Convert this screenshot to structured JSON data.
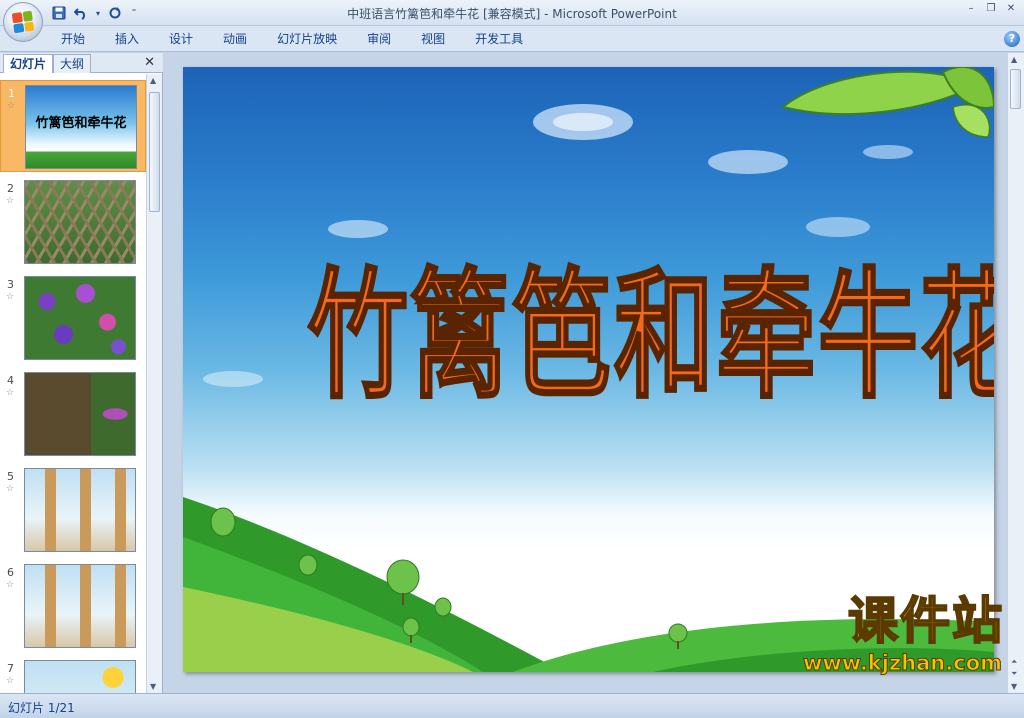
{
  "window": {
    "title": "中班语言竹篱笆和牵牛花 [兼容模式] - Microsoft PowerPoint"
  },
  "qat": {
    "save_icon": "save-icon",
    "undo_icon": "undo-icon",
    "redo_icon": "redo-icon",
    "customize_icon": "customize-qat-icon"
  },
  "ribbon": {
    "tabs": [
      "开始",
      "插入",
      "设计",
      "动画",
      "幻灯片放映",
      "审阅",
      "视图",
      "开发工具"
    ]
  },
  "pane": {
    "tab_slides": "幻灯片",
    "tab_outline": "大纲",
    "close_label": "✕"
  },
  "thumbnails": [
    {
      "number": "1",
      "caption": "竹篱笆和牵牛花"
    },
    {
      "number": "2"
    },
    {
      "number": "3"
    },
    {
      "number": "4"
    },
    {
      "number": "5"
    },
    {
      "number": "6"
    },
    {
      "number": "7"
    }
  ],
  "slide": {
    "title": "竹篱笆和牵牛花"
  },
  "watermark": {
    "name": "课件站",
    "url": "www.kjzhan.com"
  },
  "status": {
    "slide_info": "幻灯片 1/21"
  },
  "colors": {
    "accent": "#15428b",
    "title_fill": "#f26a1b",
    "selected_thumb": "#f9b865",
    "watermark": "#f5c400"
  }
}
